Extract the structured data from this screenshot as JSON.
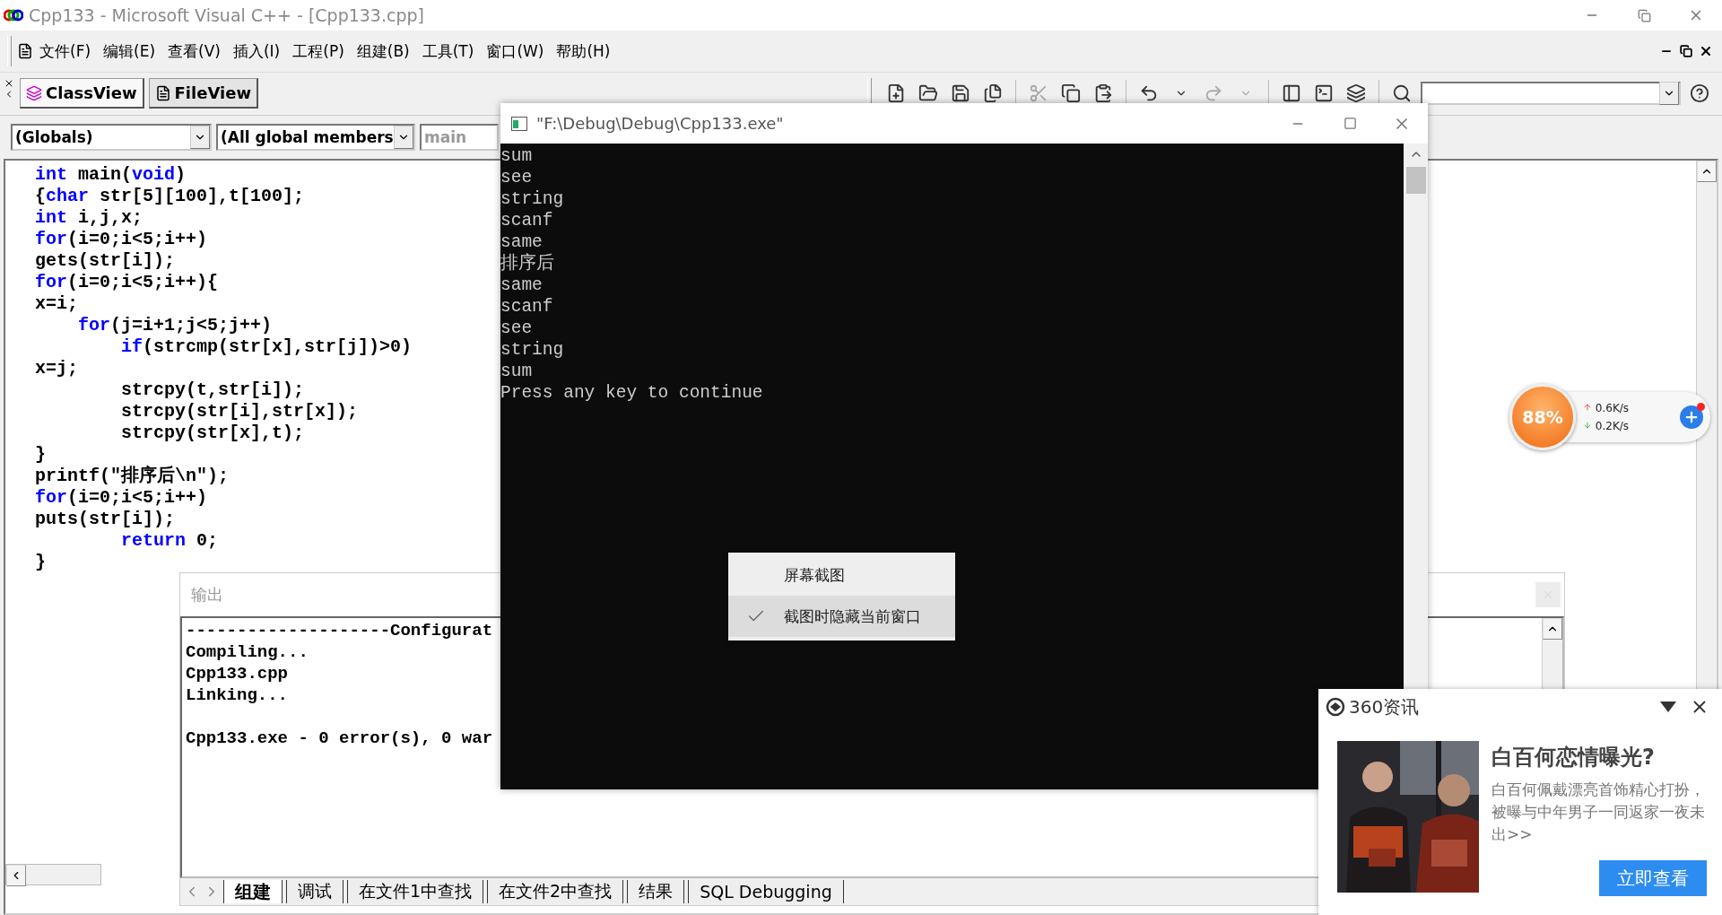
{
  "ide": {
    "title": "Cpp133 - Microsoft Visual C++ - [Cpp133.cpp]",
    "menu": [
      "文件(F)",
      "编辑(E)",
      "查看(V)",
      "插入(I)",
      "工程(P)",
      "组建(B)",
      "工具(T)",
      "窗口(W)",
      "帮助(H)"
    ],
    "workspace_tabs": [
      {
        "label": "ClassView",
        "selected": true
      },
      {
        "label": "FileView",
        "selected": false
      }
    ],
    "combos": [
      {
        "value": "(Globals)",
        "disabled": false
      },
      {
        "value": "(All global members",
        "disabled": false
      },
      {
        "value": "main",
        "disabled": true
      }
    ],
    "code": [
      [
        {
          "text": "int",
          "kind": "keyword"
        },
        {
          "text": " main(",
          "kind": "plain"
        },
        {
          "text": "void",
          "kind": "keyword"
        },
        {
          "text": ")",
          "kind": "plain"
        }
      ],
      [
        {
          "text": "{",
          "kind": "plain"
        },
        {
          "text": "char",
          "kind": "keyword"
        },
        {
          "text": " str[5][100],t[100];",
          "kind": "plain"
        }
      ],
      [
        {
          "text": "int",
          "kind": "keyword"
        },
        {
          "text": " i,j,x;",
          "kind": "plain"
        }
      ],
      [
        {
          "text": "for",
          "kind": "keyword"
        },
        {
          "text": "(i=0;i<5;i++)",
          "kind": "plain"
        }
      ],
      [
        {
          "text": "gets(str[i]);",
          "kind": "plain"
        }
      ],
      [
        {
          "text": "for",
          "kind": "keyword"
        },
        {
          "text": "(i=0;i<5;i++){",
          "kind": "plain"
        }
      ],
      [
        {
          "text": "x=i;",
          "kind": "plain"
        }
      ],
      [
        {
          "text": "    for",
          "kind": "keyword"
        },
        {
          "text": "(j=i+1;j<5;j++)",
          "kind": "plain"
        }
      ],
      [
        {
          "text": "        if",
          "kind": "keyword"
        },
        {
          "text": "(strcmp(str[x],str[j])>0)",
          "kind": "plain"
        }
      ],
      [
        {
          "text": "x=j;",
          "kind": "plain"
        }
      ],
      [
        {
          "text": "        strcpy(t,str[i]);",
          "kind": "plain"
        }
      ],
      [
        {
          "text": "        strcpy(str[i],str[x]);",
          "kind": "plain"
        }
      ],
      [
        {
          "text": "        strcpy(str[x],t);",
          "kind": "plain"
        }
      ],
      [
        {
          "text": "}",
          "kind": "plain"
        }
      ],
      [
        {
          "text": "printf(\"排序后\\n\");",
          "kind": "plain"
        }
      ],
      [
        {
          "text": "for",
          "kind": "keyword"
        },
        {
          "text": "(i=0;i<5;i++)",
          "kind": "plain"
        }
      ],
      [
        {
          "text": "puts(str[i]);",
          "kind": "plain"
        }
      ],
      [
        {
          "text": "        return",
          "kind": "keyword"
        },
        {
          "text": " 0;",
          "kind": "plain"
        }
      ],
      [
        {
          "text": "}",
          "kind": "plain"
        }
      ]
    ]
  },
  "output": {
    "title": "输出",
    "lines": [
      {
        "text": "--------------------Configurat",
        "kind": "log"
      },
      {
        "text": "Compiling...",
        "kind": "log"
      },
      {
        "text": "Cpp133.cpp",
        "kind": "log"
      },
      {
        "text": "Linking...",
        "kind": "log"
      },
      {
        "text": "Cpp133.exe - 0 error(s), 0 war",
        "kind": "summary"
      }
    ],
    "tabs": [
      {
        "label": "组建",
        "selected": true
      },
      {
        "label": "调试",
        "selected": false
      },
      {
        "label": "在文件1中查找",
        "selected": false
      },
      {
        "label": "在文件2中查找",
        "selected": false
      },
      {
        "label": "结果",
        "selected": false
      },
      {
        "label": "SQL Debugging",
        "selected": false
      }
    ]
  },
  "console": {
    "title": "\"F:\\Debug\\Debug\\Cpp133.exe\"",
    "lines": [
      "sum",
      "see",
      "string",
      "scanf",
      "same",
      "排序后",
      "same",
      "scanf",
      "see",
      "string",
      "sum",
      "Press any key to continue"
    ]
  },
  "context_menu": [
    {
      "label": "屏幕截图",
      "checked": false,
      "selected": false
    },
    {
      "label": "截图时隐藏当前窗口",
      "checked": true,
      "selected": true
    }
  ],
  "net_widget": {
    "percent": "88%",
    "upload": "0.6K/s",
    "download": "0.2K/s"
  },
  "news_popup": {
    "title": "360资讯",
    "headline": "白百何恋情曝光?",
    "body": "白百何佩戴漂亮首饰精心打扮，被曝与中年男子一同返家一夜未出>>",
    "button": "立即查看"
  }
}
